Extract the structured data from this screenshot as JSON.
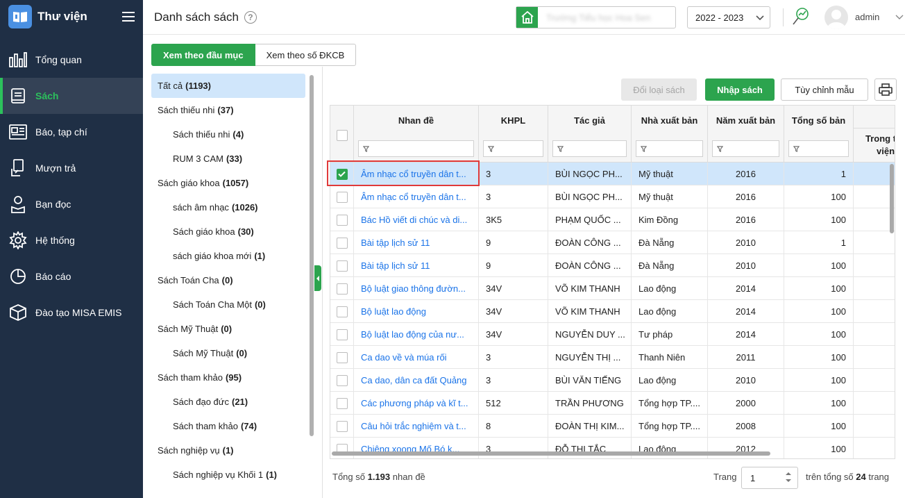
{
  "app": {
    "title": "Thư viện"
  },
  "sidebar": {
    "items": [
      {
        "label": "Tổng quan",
        "icon": "chart-bars-icon"
      },
      {
        "label": "Sách",
        "icon": "book-icon",
        "active": true
      },
      {
        "label": "Báo, tạp chí",
        "icon": "newspaper-icon"
      },
      {
        "label": "Mượn trả",
        "icon": "borrow-return-icon"
      },
      {
        "label": "Bạn đọc",
        "icon": "reader-icon"
      },
      {
        "label": "Hệ thống",
        "icon": "gear-icon"
      },
      {
        "label": "Báo cáo",
        "icon": "pie-chart-icon"
      },
      {
        "label": "Đào tạo MISA EMIS",
        "icon": "cube-icon"
      }
    ]
  },
  "header": {
    "page_title": "Danh sách sách",
    "school_name": "Trường Tiểu học Hoa Sen",
    "year": "2022 - 2023",
    "user": "admin"
  },
  "tabs": [
    "Xem theo đầu mục",
    "Xem theo số ĐKCB"
  ],
  "categories": [
    {
      "label": "Tất cả",
      "count": "(1193)",
      "level": 0,
      "selected": true
    },
    {
      "label": "Sách thiếu nhi",
      "count": "(37)",
      "level": 0
    },
    {
      "label": "Sách thiếu nhi",
      "count": "(4)",
      "level": 1
    },
    {
      "label": "RUM 3 CAM",
      "count": "(33)",
      "level": 1
    },
    {
      "label": "Sách giáo khoa",
      "count": "(1057)",
      "level": 0
    },
    {
      "label": "sách âm nhạc",
      "count": "(1026)",
      "level": 1
    },
    {
      "label": "Sách giáo khoa",
      "count": "(30)",
      "level": 1
    },
    {
      "label": "sách giáo khoa mới",
      "count": "(1)",
      "level": 1
    },
    {
      "label": "Sách Toán Cha",
      "count": "(0)",
      "level": 0
    },
    {
      "label": "Sách Toán Cha Một",
      "count": "(0)",
      "level": 1
    },
    {
      "label": "Sách Mỹ Thuật",
      "count": "(0)",
      "level": 0
    },
    {
      "label": "Sách Mỹ Thuật",
      "count": "(0)",
      "level": 1
    },
    {
      "label": "Sách tham khảo",
      "count": "(95)",
      "level": 0
    },
    {
      "label": "Sách đạo đức",
      "count": "(21)",
      "level": 1
    },
    {
      "label": "Sách tham khảo",
      "count": "(74)",
      "level": 1
    },
    {
      "label": "Sách nghiệp vụ",
      "count": "(1)",
      "level": 0
    },
    {
      "label": "Sách nghiệp vụ Khối 1",
      "count": "(1)",
      "level": 1
    }
  ],
  "toolbar": {
    "change_type": "Đổi loại sách",
    "import": "Nhập sách",
    "customize": "Tùy chỉnh mẫu"
  },
  "grid": {
    "columns": [
      "Nhan đề",
      "KHPL",
      "Tác giả",
      "Nhà xuất bản",
      "Năm xuất bản",
      "Tổng số bản"
    ],
    "extra_column": [
      "Trong t",
      "viện"
    ],
    "rows": [
      {
        "title": "Âm nhạc cổ truyền dân t...",
        "khpl": "3",
        "author": "BÙI NGỌC PH...",
        "publisher": "Mỹ thuật",
        "year": "2016",
        "total": "1",
        "selected": true
      },
      {
        "title": "Âm nhạc cổ truyền dân t...",
        "khpl": "3",
        "author": "BÙI NGỌC PH...",
        "publisher": "Mỹ thuật",
        "year": "2016",
        "total": "100"
      },
      {
        "title": "Bác Hồ viết di chúc và di...",
        "khpl": "3K5",
        "author": "PHẠM QUỐC ...",
        "publisher": "Kim Đồng",
        "year": "2016",
        "total": "100"
      },
      {
        "title": "Bài tập lịch sử 11",
        "khpl": "9",
        "author": "ĐOÀN CÔNG ...",
        "publisher": "Đà Nẵng",
        "year": "2010",
        "total": "1"
      },
      {
        "title": "Bài tập lịch sử 11",
        "khpl": "9",
        "author": "ĐOÀN CÔNG ...",
        "publisher": "Đà Nẵng",
        "year": "2010",
        "total": "100"
      },
      {
        "title": "Bộ luật giao thông đườn...",
        "khpl": "34V",
        "author": "VÕ KIM THANH",
        "publisher": "Lao động",
        "year": "2014",
        "total": "100"
      },
      {
        "title": "Bộ luật lao động",
        "khpl": "34V",
        "author": "VÕ KIM THANH",
        "publisher": "Lao động",
        "year": "2014",
        "total": "100"
      },
      {
        "title": "Bộ luật lao động của nư...",
        "khpl": "34V",
        "author": "NGUYỄN DUY ...",
        "publisher": "Tư pháp",
        "year": "2014",
        "total": "100"
      },
      {
        "title": "Ca dao về và múa rối",
        "khpl": "3",
        "author": "NGUYỄN THỊ ...",
        "publisher": "Thanh Niên",
        "year": "2011",
        "total": "100"
      },
      {
        "title": "Ca dao, dân ca đất Quảng",
        "khpl": "3",
        "author": "BÙI VĂN TIẾNG",
        "publisher": "Lao động",
        "year": "2010",
        "total": "100"
      },
      {
        "title": "Các phương pháp và kĩ t...",
        "khpl": "512",
        "author": "TRẦN PHƯƠNG",
        "publisher": "Tổng hợp TP....",
        "year": "2000",
        "total": "100"
      },
      {
        "title": "Câu hỏi trắc nghiệm và t...",
        "khpl": "8",
        "author": "ĐOÀN THỊ KIM...",
        "publisher": "Tổng hợp TP....",
        "year": "2008",
        "total": "100"
      },
      {
        "title": "Chiêng xoong Mố Bó k...",
        "khpl": "3",
        "author": "ĐỖ THỊ TẮC",
        "publisher": "Lao động",
        "year": "2012",
        "total": "100"
      }
    ]
  },
  "footer": {
    "total_prefix": "Tổng số",
    "total_count": "1.193",
    "total_suffix": "nhan đề",
    "page_label": "Trang",
    "page_value": "1",
    "pages_prefix": "trên tổng số",
    "pages_total": "24",
    "pages_suffix": "trang"
  },
  "colors": {
    "sidebar": "#1f2f45",
    "primary": "#2ca44e",
    "link": "#1a73e8",
    "selected_row": "#d0e6fb"
  }
}
